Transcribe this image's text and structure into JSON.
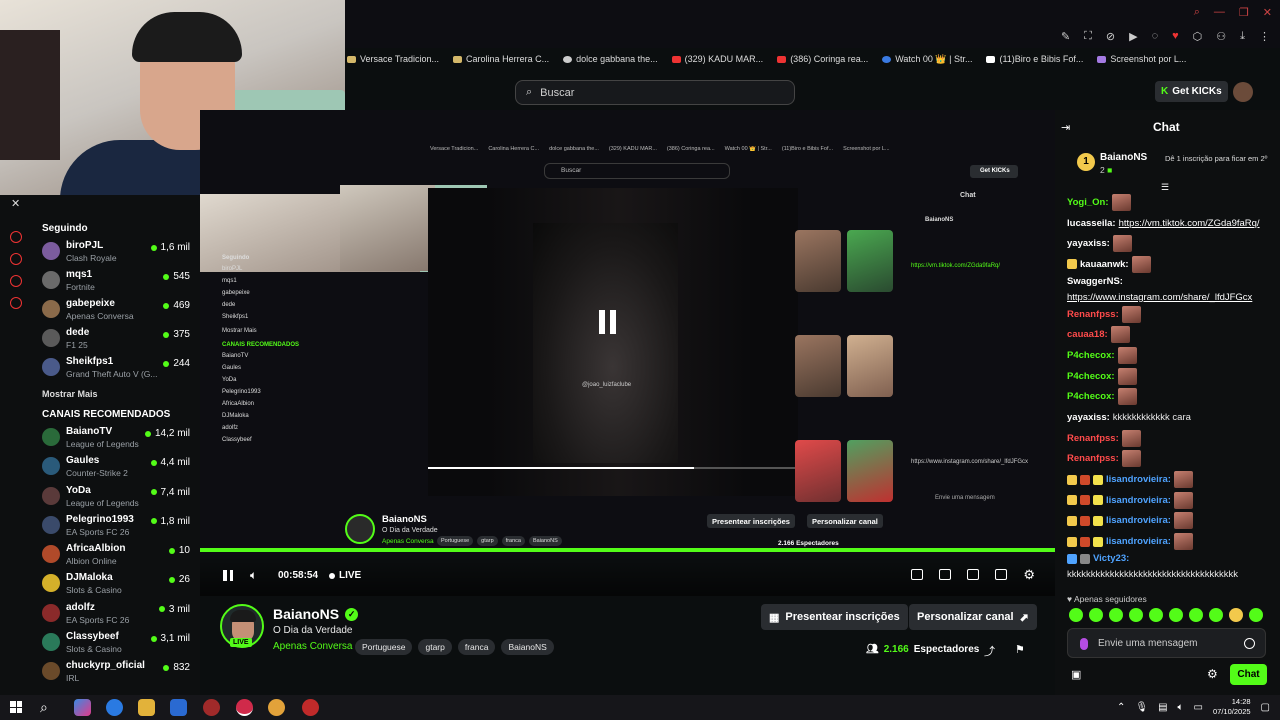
{
  "bookmarks": [
    "Versace Tradicion...",
    "Carolina Herrera C...",
    "dolce gabbana the...",
    "(329) KADU MAR...",
    "(386) Coringa rea...",
    "Watch 00 👑 | Str...",
    "(11)Biro e Bibis Fof...",
    "Screenshot por L..."
  ],
  "header": {
    "search_placeholder": "Buscar",
    "get_kicks_label": "Get KICKs",
    "get_kicks_icon": "K"
  },
  "sidebar": {
    "following_heading": "Seguindo",
    "following": [
      {
        "name": "biroPJL",
        "category": "Clash Royale",
        "viewers": "1,6 mil",
        "color": "#7b5c9e"
      },
      {
        "name": "mqs1",
        "category": "Fortnite",
        "viewers": "545",
        "color": "#6a6a6a"
      },
      {
        "name": "gabepeixe",
        "category": "Apenas Conversa",
        "viewers": "469",
        "color": "#8a6a4a"
      },
      {
        "name": "dede",
        "category": "F1 25",
        "viewers": "375",
        "color": "#5a5a5a"
      },
      {
        "name": "Sheikfps1",
        "category": "Grand Theft Auto V (G...",
        "viewers": "244",
        "color": "#4a5a8a"
      }
    ],
    "show_more": "Mostrar Mais",
    "recommended_heading": "CANAIS RECOMENDADOS",
    "recommended": [
      {
        "name": "BaianoTV",
        "category": "League of Legends",
        "viewers": "14,2 mil",
        "color": "#2a6a3a"
      },
      {
        "name": "Gaules",
        "category": "Counter-Strike 2",
        "viewers": "4,4 mil",
        "color": "#2a5a7a"
      },
      {
        "name": "YoDa",
        "category": "League of Legends",
        "viewers": "7,4 mil",
        "color": "#5a3a3a"
      },
      {
        "name": "Pelegrino1993",
        "category": "EA Sports FC 26",
        "viewers": "1,8 mil",
        "color": "#3a4a6a"
      },
      {
        "name": "AfricaAlbion",
        "category": "Albion Online",
        "viewers": "10",
        "color": "#b04a2a"
      },
      {
        "name": "DJMaloka",
        "category": "Slots & Casino",
        "viewers": "26",
        "color": "#d4b02a"
      },
      {
        "name": "adolfz",
        "category": "EA Sports FC 26",
        "viewers": "3 mil",
        "color": "#8a2a2a"
      },
      {
        "name": "Classybeef",
        "category": "Slots & Casino",
        "viewers": "3,1 mil",
        "color": "#2a7a5a"
      },
      {
        "name": "chuckyrp_oficial",
        "category": "IRL",
        "viewers": "832",
        "color": "#6a4a2a"
      }
    ]
  },
  "nested": {
    "search": "Buscar",
    "get_kicks": "Get KICKs",
    "video_handle": "@joao_luizfaclube",
    "channel_name": "BaianoNS",
    "title": "O Dia da Verdade",
    "category": "Apenas Conversa",
    "tags": [
      "Portuguese",
      "gtarp",
      "franca",
      "BaianoNS"
    ],
    "btn_gift": "Presentear inscrições",
    "btn_customize": "Personalizar canal",
    "viewers": "2.166 Espectadores"
  },
  "player": {
    "time": "00:58:54",
    "live_label": "LIVE"
  },
  "channel": {
    "name": "BaianoNS",
    "live_badge": "LIVE",
    "title": "O Dia da Verdade",
    "category": "Apenas Conversa",
    "tags": [
      "Portuguese",
      "gtarp",
      "franca",
      "BaianoNS"
    ],
    "gift_button": "Presentear inscrições",
    "customize_button": "Personalizar canal",
    "viewers_count": "2.166",
    "viewers_label": "Espectadores"
  },
  "chat": {
    "title": "Chat",
    "pinned": {
      "rank": "1",
      "name": "BaianoNS",
      "count": "2",
      "note": "Dê 1 inscrição para ficar em 2º"
    },
    "messages": [
      {
        "user": "Yogi_On:",
        "color": "#53fc18",
        "text": "",
        "link": "",
        "emotes": 1
      },
      {
        "user": "lucasseila:",
        "color": "#ffffff",
        "text": "",
        "link": "https://vm.tiktok.com/ZGda9faRq/",
        "emotes": 0
      },
      {
        "user": "yayaxiss:",
        "color": "#ffffff",
        "text": "",
        "link": "",
        "emotes": 1
      },
      {
        "user": "kauaanwk:",
        "color": "#ffffff",
        "text": "",
        "link": "",
        "emotes": 1
      },
      {
        "user": "SwaggerNS:",
        "color": "#ffffff",
        "text": "",
        "link": "https://www.instagram.com/share/_lfdJFGcx",
        "emotes": 0
      },
      {
        "user": "Renanfpss:",
        "color": "#ff4b4b",
        "text": "",
        "link": "",
        "emotes": 1
      },
      {
        "user": "cauaa18:",
        "color": "#ff4b4b",
        "text": "",
        "link": "",
        "emotes": 1
      },
      {
        "user": "P4checox:",
        "color": "#53fc18",
        "text": "",
        "link": "",
        "emotes": 1
      },
      {
        "user": "P4checox:",
        "color": "#53fc18",
        "text": "",
        "link": "",
        "emotes": 1
      },
      {
        "user": "P4checox:",
        "color": "#53fc18",
        "text": "",
        "link": "",
        "emotes": 1
      },
      {
        "user": "yayaxiss:",
        "color": "#ffffff",
        "text": "kkkkkkkkkkkk cara",
        "link": "",
        "emotes": 0
      },
      {
        "user": "Renanfpss:",
        "color": "#ff4b4b",
        "text": "",
        "link": "",
        "emotes": 1
      },
      {
        "user": "Renanfpss:",
        "color": "#ff4b4b",
        "text": "",
        "link": "",
        "emotes": 1
      },
      {
        "user": "lisandrovieira:",
        "color": "#4fa3ff",
        "text": "",
        "link": "",
        "emotes": 1
      },
      {
        "user": "lisandrovieira:",
        "color": "#4fa3ff",
        "text": "",
        "link": "",
        "emotes": 1
      },
      {
        "user": "lisandrovieira:",
        "color": "#4fa3ff",
        "text": "",
        "link": "",
        "emotes": 1
      },
      {
        "user": "lisandrovieira:",
        "color": "#4fa3ff",
        "text": "",
        "link": "",
        "emotes": 1
      },
      {
        "user": "Victy23:",
        "color": "#4fa3ff",
        "text": "kkkkkkkkkkkkkkkkkkkkkkkkkkkkkkkkkkkk",
        "link": "",
        "emotes": 0
      }
    ],
    "supporters_label": "Apenas seguidores",
    "input_placeholder": "Envie uma mensagem",
    "send_button": "Chat"
  },
  "taskbar": {
    "time": "14:28",
    "date": "07/10/2025"
  }
}
